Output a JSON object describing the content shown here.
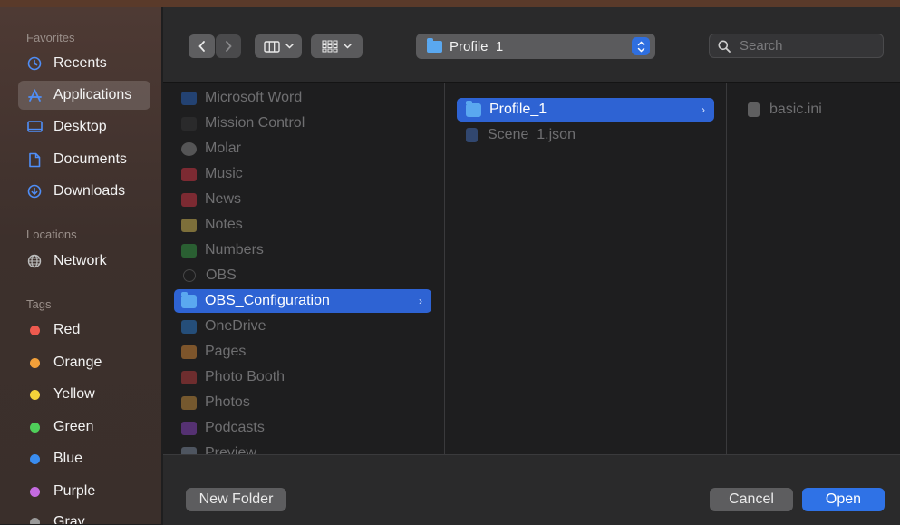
{
  "sidebar": {
    "favorites_title": "Favorites",
    "favorites": [
      {
        "label": "Recents",
        "icon": "clock-icon"
      },
      {
        "label": "Applications",
        "icon": "applications-icon"
      },
      {
        "label": "Desktop",
        "icon": "desktop-icon"
      },
      {
        "label": "Documents",
        "icon": "document-icon"
      },
      {
        "label": "Downloads",
        "icon": "download-icon"
      }
    ],
    "locations_title": "Locations",
    "locations": [
      {
        "label": "Network",
        "icon": "network-icon"
      }
    ],
    "tags_title": "Tags",
    "tags": [
      {
        "label": "Red",
        "color": "#ee5a4f"
      },
      {
        "label": "Orange",
        "color": "#f2a03a"
      },
      {
        "label": "Yellow",
        "color": "#f4d33a"
      },
      {
        "label": "Green",
        "color": "#4fcf5a"
      },
      {
        "label": "Blue",
        "color": "#3a8df0"
      },
      {
        "label": "Purple",
        "color": "#c46be0"
      },
      {
        "label": "Gray",
        "color": "#9a9a9a"
      }
    ]
  },
  "toolbar": {
    "back_icon": "chevron-left-icon",
    "forward_icon": "chevron-right-icon",
    "view_icon": "column-view-icon",
    "group_icon": "group-icon",
    "path_label": "Profile_1",
    "search_placeholder": "Search"
  },
  "columns": {
    "col1": [
      {
        "label": "Microsoft Word",
        "icon_color": "#2b6fd6"
      },
      {
        "label": "Mission Control",
        "icon_color": "#3a3a3a"
      },
      {
        "label": "Molar",
        "icon_color": "#9a9a9a"
      },
      {
        "label": "Music",
        "icon_color": "#f03a4a"
      },
      {
        "label": "News",
        "icon_color": "#f03a4a"
      },
      {
        "label": "Notes",
        "icon_color": "#f2d35a"
      },
      {
        "label": "Numbers",
        "icon_color": "#3ab04a"
      },
      {
        "label": "OBS",
        "icon_color": "#555555"
      },
      {
        "label": "OBS_Configuration",
        "icon_color": "#5aa8f0"
      },
      {
        "label": "OneDrive",
        "icon_color": "#2f8ae6"
      },
      {
        "label": "Pages",
        "icon_color": "#f29a3a"
      },
      {
        "label": "Photo Booth",
        "icon_color": "#d04040"
      },
      {
        "label": "Photos",
        "icon_color": "#e0a040"
      },
      {
        "label": "Podcasts",
        "icon_color": "#9a4ad6"
      },
      {
        "label": "Preview",
        "icon_color": "#8a9ab0"
      }
    ],
    "col2": [
      {
        "label": "Profile_1"
      },
      {
        "label": "Scene_1.json"
      }
    ],
    "col3": [
      {
        "label": "basic.ini"
      }
    ]
  },
  "footer": {
    "new_folder": "New Folder",
    "cancel": "Cancel",
    "open": "Open"
  }
}
